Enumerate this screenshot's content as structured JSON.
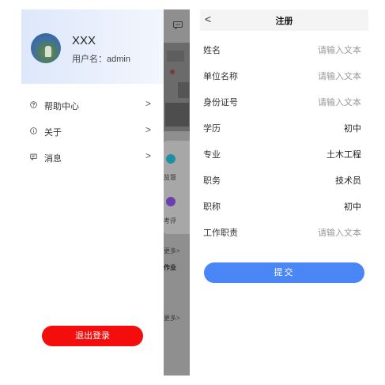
{
  "colors": {
    "accent_blue": "#4a86f5",
    "logout_red": "#f30d0d",
    "header_gradient": "#dde8fb"
  },
  "drawer": {
    "user_name": "XXX",
    "user_id": "用户名：admin",
    "menu": [
      {
        "label": "帮助中心",
        "icon": "help-circle-icon"
      },
      {
        "label": "关于",
        "icon": "info-icon"
      },
      {
        "label": "消息",
        "icon": "message-icon"
      }
    ],
    "logout_label": "退出登录"
  },
  "background_app": {
    "items": [
      "监督",
      "考评",
      "更多>",
      "作业",
      "更多>"
    ]
  },
  "register": {
    "title": "注册",
    "back_icon": "chevron-left-icon",
    "fields": [
      {
        "label": "姓名",
        "value": "请输入文本",
        "placeholder": true
      },
      {
        "label": "单位名称",
        "value": "请输入文本",
        "placeholder": true
      },
      {
        "label": "身份证号",
        "value": "请输入文本",
        "placeholder": true
      },
      {
        "label": "学历",
        "value": "初中",
        "placeholder": false
      },
      {
        "label": "专业",
        "value": "土木工程",
        "placeholder": false
      },
      {
        "label": "职务",
        "value": "技术员",
        "placeholder": false
      },
      {
        "label": "职称",
        "value": "初中",
        "placeholder": false
      },
      {
        "label": "工作职责",
        "value": "请输入文本",
        "placeholder": true
      }
    ],
    "submit_label": "提交"
  }
}
